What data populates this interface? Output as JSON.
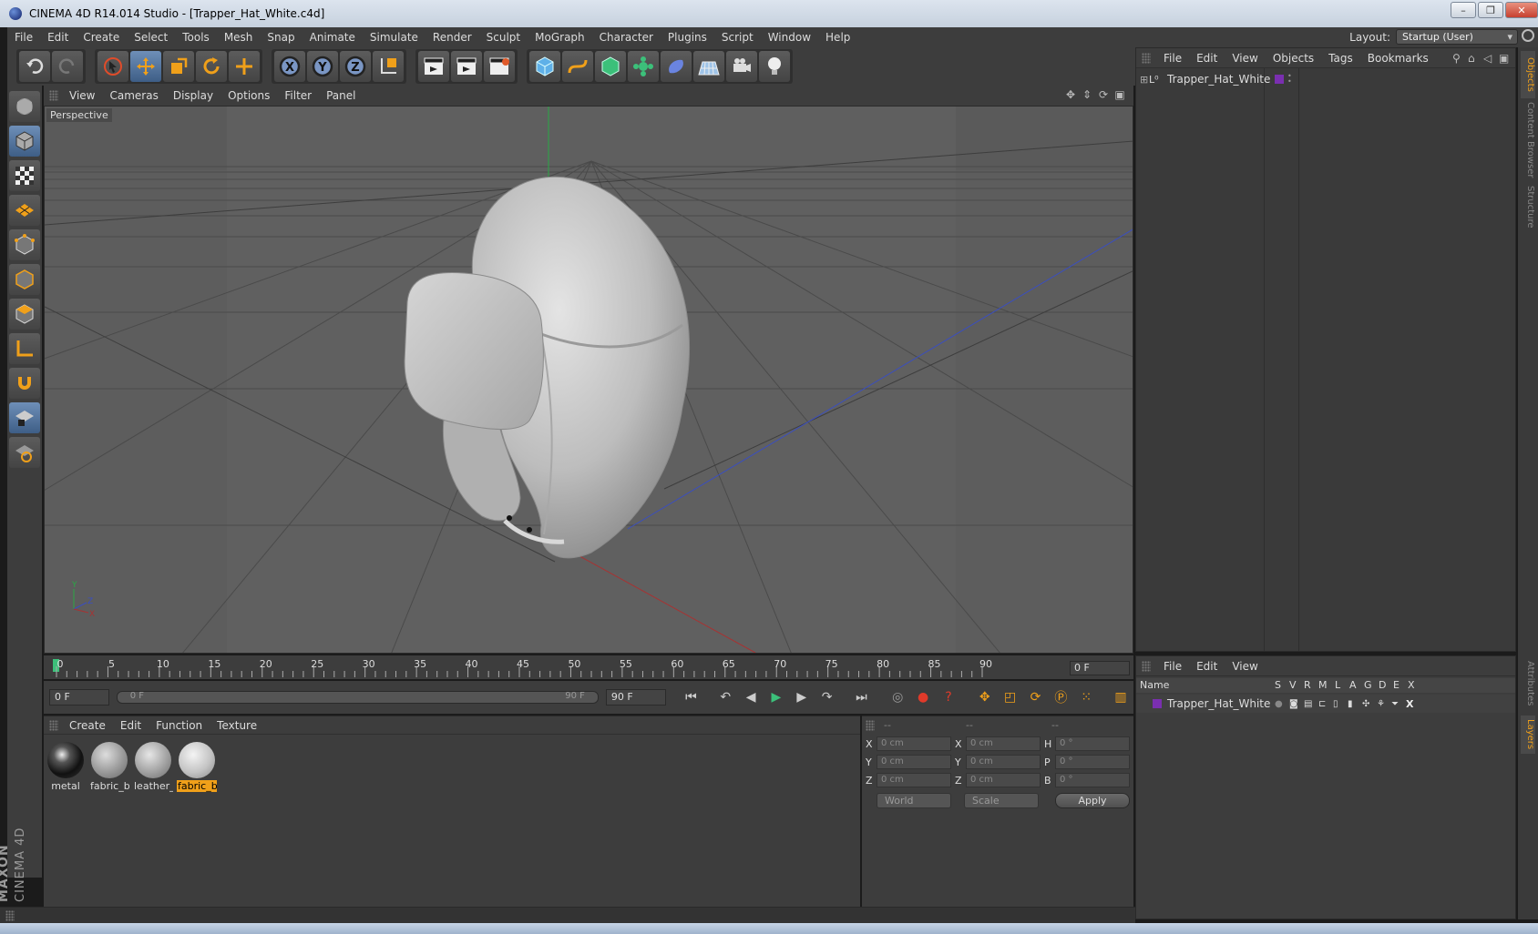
{
  "window": {
    "title": "CINEMA 4D R14.014 Studio - [Trapper_Hat_White.c4d]",
    "buttons": {
      "minimize": "–",
      "restore": "❐",
      "close": "✕"
    }
  },
  "menubar": {
    "items": [
      "File",
      "Edit",
      "Create",
      "Select",
      "Tools",
      "Mesh",
      "Snap",
      "Animate",
      "Simulate",
      "Render",
      "Sculpt",
      "MoGraph",
      "Character",
      "Plugins",
      "Script",
      "Window",
      "Help"
    ],
    "layout_label": "Layout:",
    "layout_value": "Startup (User)"
  },
  "viewport": {
    "menu": [
      "View",
      "Cameras",
      "Display",
      "Options",
      "Filter",
      "Panel"
    ],
    "camera_label": "Perspective",
    "axis_labels": {
      "y": "Y",
      "z": "Z",
      "x": "X"
    },
    "colors": {
      "background": "#5d5d5d",
      "grid": "#4a4a4a",
      "x_axis": "#a83232",
      "y_axis": "#2aa845",
      "z_axis": "#3a4ec0",
      "model": "#c9c9c9"
    }
  },
  "timeline": {
    "ticks": [
      "0",
      "5",
      "10",
      "15",
      "20",
      "25",
      "30",
      "35",
      "40",
      "45",
      "50",
      "55",
      "60",
      "65",
      "70",
      "75",
      "80",
      "85",
      "90"
    ],
    "current_frame": "0 F"
  },
  "transport": {
    "start_field": "0 F",
    "range_start": "0 F",
    "range_end": "90 F",
    "end_field": "90 F"
  },
  "materials": {
    "menu": [
      "Create",
      "Edit",
      "Function",
      "Texture"
    ],
    "items": [
      {
        "label": "metal",
        "selected": false
      },
      {
        "label": "fabric_b",
        "selected": false
      },
      {
        "label": "leather_",
        "selected": false
      },
      {
        "label": "fabric_b",
        "selected": true
      }
    ]
  },
  "coordinates": {
    "headers": [
      "--",
      "--",
      "--"
    ],
    "rows": [
      {
        "a1": "X",
        "v1": "0 cm",
        "a2": "X",
        "v2": "0 cm",
        "a3": "H",
        "v3": "0 °"
      },
      {
        "a1": "Y",
        "v1": "0 cm",
        "a2": "Y",
        "v2": "0 cm",
        "a3": "P",
        "v3": "0 °"
      },
      {
        "a1": "Z",
        "v1": "0 cm",
        "a2": "Z",
        "v2": "0 cm",
        "a3": "B",
        "v3": "0 °"
      }
    ],
    "coord_system": "World",
    "mode": "Scale",
    "apply_label": "Apply"
  },
  "objects": {
    "menu": [
      "File",
      "Edit",
      "View",
      "Objects",
      "Tags",
      "Bookmarks"
    ],
    "items": [
      {
        "name": "Trapper_Hat_White",
        "layer_color": "#7a2fb0"
      }
    ]
  },
  "layers": {
    "menu": [
      "File",
      "Edit",
      "View"
    ],
    "columns": [
      "Name",
      "S",
      "V",
      "R",
      "M",
      "L",
      "A",
      "G",
      "D",
      "E",
      "X"
    ],
    "items": [
      {
        "name": "Trapper_Hat_White",
        "color": "#7a2fb0"
      }
    ]
  },
  "right_tabs": [
    "Objects",
    "Content Browser",
    "Structure",
    "Attributes",
    "Layers"
  ],
  "logo": {
    "brand": "MAXON",
    "product": "CINEMA 4D"
  }
}
